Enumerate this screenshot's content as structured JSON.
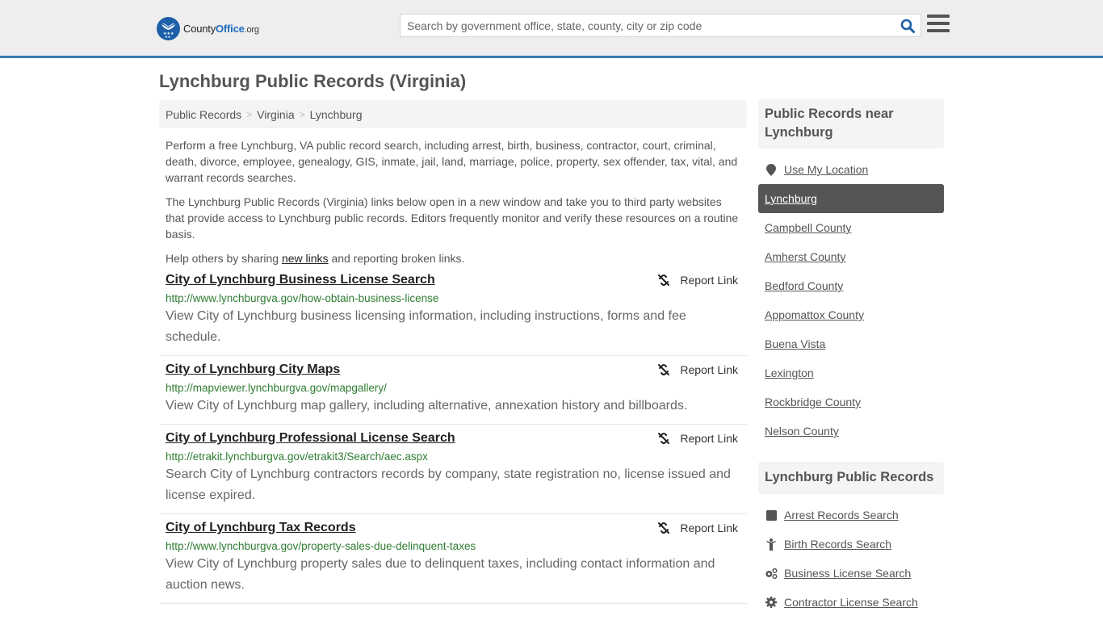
{
  "header": {
    "logo": {
      "brand_part1": "County",
      "brand_part2": "Office",
      "brand_part3": ".org"
    },
    "search": {
      "placeholder": "Search by government office, state, county, city or zip code",
      "value": ""
    },
    "colors": {
      "accent": "#3a7cb5",
      "brand_blue": "#1d5fa8",
      "header_bg": "#eeeeee"
    }
  },
  "page": {
    "title": "Lynchburg Public Records (Virginia)",
    "breadcrumb": [
      "Public Records",
      "Virginia",
      "Lynchburg"
    ],
    "breadcrumb_separator": ">",
    "intro": {
      "p1": "Perform a free Lynchburg, VA public record search, including arrest, birth, business, contractor, court, criminal, death, divorce, employee, genealogy, GIS, inmate, jail, land, marriage, police, property, sex offender, tax, vital, and warrant records searches.",
      "p2": "The Lynchburg Public Records (Virginia) links below open in a new window and take you to third party websites that provide access to Lynchburg public records. Editors frequently monitor and verify these resources on a routine basis.",
      "p3_before": "Help others by sharing ",
      "p3_link": "new links",
      "p3_after": " and reporting broken links."
    },
    "report_link_label": "Report Link",
    "records": [
      {
        "title": "City of Lynchburg Business License Search",
        "url": "http://www.lynchburgva.gov/how-obtain-business-license",
        "description": "View City of Lynchburg business licensing information, including instructions, forms and fee schedule."
      },
      {
        "title": "City of Lynchburg City Maps",
        "url": "http://mapviewer.lynchburgva.gov/mapgallery/",
        "description": "View City of Lynchburg map gallery, including alternative, annexation history and billboards."
      },
      {
        "title": "City of Lynchburg Professional License Search",
        "url": "http://etrakit.lynchburgva.gov/etrakit3/Search/aec.aspx",
        "description": "Search City of Lynchburg contractors records by company, state registration no, license issued and license expired."
      },
      {
        "title": "City of Lynchburg Tax Records",
        "url": "http://www.lynchburgva.gov/property-sales-due-delinquent-taxes",
        "description": "View City of Lynchburg property sales due to delinquent taxes, including contact information and auction news."
      }
    ]
  },
  "sidebar": {
    "nearby_heading": "Public Records near Lynchburg",
    "use_location": "Use My Location",
    "nearby": [
      {
        "label": "Lynchburg",
        "active": true
      },
      {
        "label": "Campbell County"
      },
      {
        "label": "Amherst County"
      },
      {
        "label": "Bedford County"
      },
      {
        "label": "Appomattox County"
      },
      {
        "label": "Buena Vista"
      },
      {
        "label": "Lexington"
      },
      {
        "label": "Rockbridge County"
      },
      {
        "label": "Nelson County"
      }
    ],
    "records_heading": "Lynchburg Public Records",
    "record_links": [
      {
        "label": "Arrest Records Search",
        "icon": "arrest-icon"
      },
      {
        "label": "Birth Records Search",
        "icon": "birth-icon"
      },
      {
        "label": "Business License Search",
        "icon": "gears-icon"
      },
      {
        "label": "Contractor License Search",
        "icon": "gear-icon"
      }
    ]
  }
}
